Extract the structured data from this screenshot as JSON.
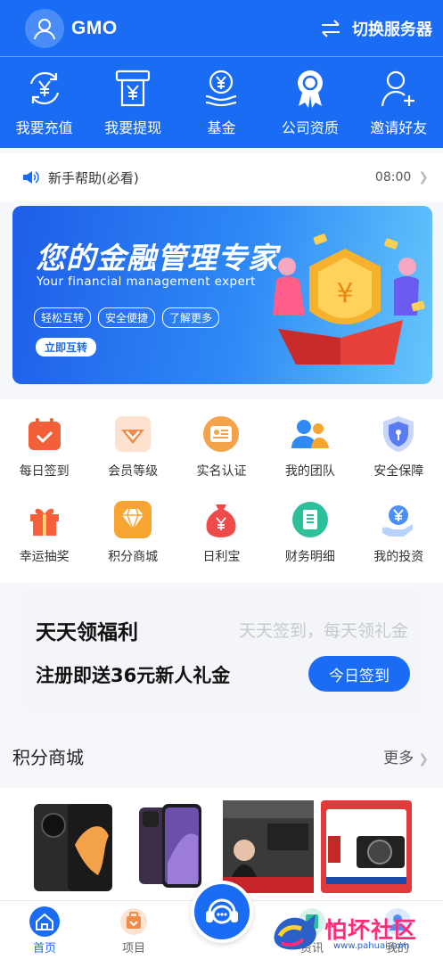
{
  "header": {
    "brand": "GMO",
    "switch_label": "切换服务器",
    "quick_actions": [
      {
        "label": "我要充值",
        "icon": "recharge-icon"
      },
      {
        "label": "我要提现",
        "icon": "withdraw-icon"
      },
      {
        "label": "基金",
        "icon": "fund-icon"
      },
      {
        "label": "公司资质",
        "icon": "certificate-icon"
      },
      {
        "label": "邀请好友",
        "icon": "invite-icon"
      }
    ]
  },
  "notice": {
    "text": "新手帮助(必看)",
    "time": "08:00"
  },
  "banner": {
    "title": "您的金融管理专家",
    "subtitle": "Your financial management expert",
    "tags": [
      "轻松互转",
      "安全便捷",
      "了解更多"
    ],
    "button": "立即互转"
  },
  "grid": [
    {
      "label": "每日签到",
      "icon": "calendar-icon",
      "color": "#f2603a"
    },
    {
      "label": "会员等级",
      "icon": "vip-icon",
      "color": "#f08c4a"
    },
    {
      "label": "实名认证",
      "icon": "id-card-icon",
      "color": "#f5a34a"
    },
    {
      "label": "我的团队",
      "icon": "team-icon",
      "color": "#2f8af6"
    },
    {
      "label": "安全保障",
      "icon": "shield-icon",
      "color": "#5b7cf0"
    },
    {
      "label": "幸运抽奖",
      "icon": "gift-icon",
      "color": "#f5603a"
    },
    {
      "label": "积分商城",
      "icon": "diamond-icon",
      "color": "#f7a532"
    },
    {
      "label": "日利宝",
      "icon": "money-bag-icon",
      "color": "#ef4b4b"
    },
    {
      "label": "财务明细",
      "icon": "ledger-icon",
      "color": "#2cc09a"
    },
    {
      "label": "我的投资",
      "icon": "investment-icon",
      "color": "#4d8ff6"
    }
  ],
  "welfare": {
    "title": "天天领福利",
    "subtitle": "天天签到，每天领礼金",
    "desc": "注册即送36元新人礼金",
    "button": "今日签到"
  },
  "mall": {
    "title": "积分商城",
    "more": "更多"
  },
  "tabbar": {
    "items": [
      {
        "label": "首页",
        "icon": "home-icon",
        "active": true
      },
      {
        "label": "项目",
        "icon": "project-icon",
        "active": false
      },
      {
        "label": "资讯",
        "icon": "news-icon",
        "active": false
      },
      {
        "label": "我的",
        "icon": "profile-icon",
        "active": false
      }
    ]
  },
  "watermark": {
    "text": "怕坏社区",
    "url": "www.pahuai.com"
  },
  "colors": {
    "primary": "#1a6cf5",
    "background": "#f6f7fb"
  }
}
